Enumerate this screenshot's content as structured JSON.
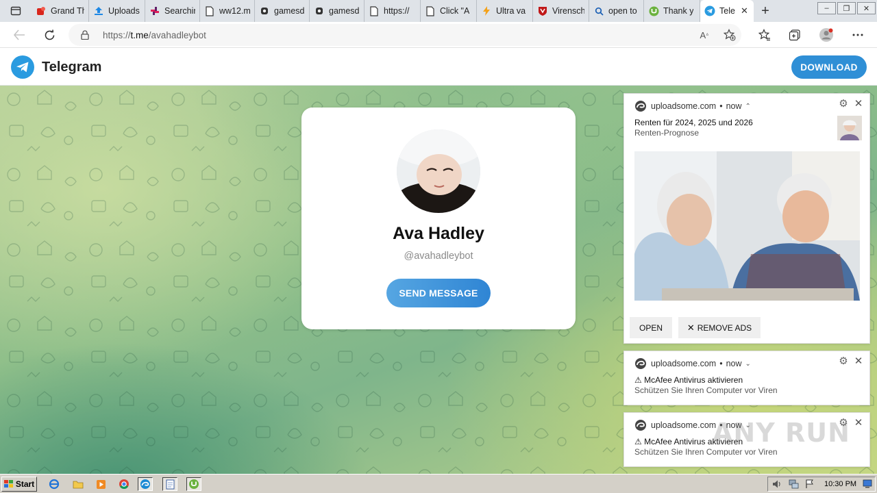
{
  "browser": {
    "tabs": [
      {
        "title": "Grand Th",
        "icon": "red-app-icon"
      },
      {
        "title": "Uploads",
        "icon": "upload-icon"
      },
      {
        "title": "Searchin",
        "icon": "slack-icon"
      },
      {
        "title": "ww12.m",
        "icon": "page-icon"
      },
      {
        "title": "gamesd",
        "icon": "gamepad-icon"
      },
      {
        "title": "gamesd",
        "icon": "gamepad-icon"
      },
      {
        "title": "https://",
        "icon": "page-icon"
      },
      {
        "title": "Click \"A",
        "icon": "page-icon"
      },
      {
        "title": "Ultra va",
        "icon": "lightning-icon"
      },
      {
        "title": "Virensch",
        "icon": "mcafee-icon"
      },
      {
        "title": "open to",
        "icon": "search-icon"
      },
      {
        "title": "Thank y",
        "icon": "utorrent-icon"
      },
      {
        "title": "Tele",
        "icon": "telegram-icon",
        "active": true
      }
    ],
    "url_prefix": "https://",
    "url_host": "t.me",
    "url_path": "/avahadleybot"
  },
  "telegram": {
    "brand": "Telegram",
    "download_label": "DOWNLOAD",
    "profile_name": "Ava Hadley",
    "profile_username": "@avahadleybot",
    "send_label": "SEND MESSAGE",
    "brand_color": "#2a9be0"
  },
  "notifications": [
    {
      "source": "uploadsome.com",
      "time": "now",
      "title": "Renten für 2024, 2025 und 2026",
      "body": "Renten-Prognose",
      "open_label": "OPEN",
      "remove_label": "REMOVE ADS"
    },
    {
      "source": "uploadsome.com",
      "time": "now",
      "title": "⚠ McAfee Antivirus aktivieren",
      "body": "Schützen Sie Ihren Computer vor Viren"
    },
    {
      "source": "uploadsome.com",
      "time": "now",
      "title": "⚠ McAfee Antivirus aktivieren",
      "body": "Schützen Sie Ihren Computer vor Viren"
    }
  ],
  "watermark": "ANY RUN",
  "taskbar": {
    "start_label": "Start",
    "clock": "10:30 PM"
  }
}
